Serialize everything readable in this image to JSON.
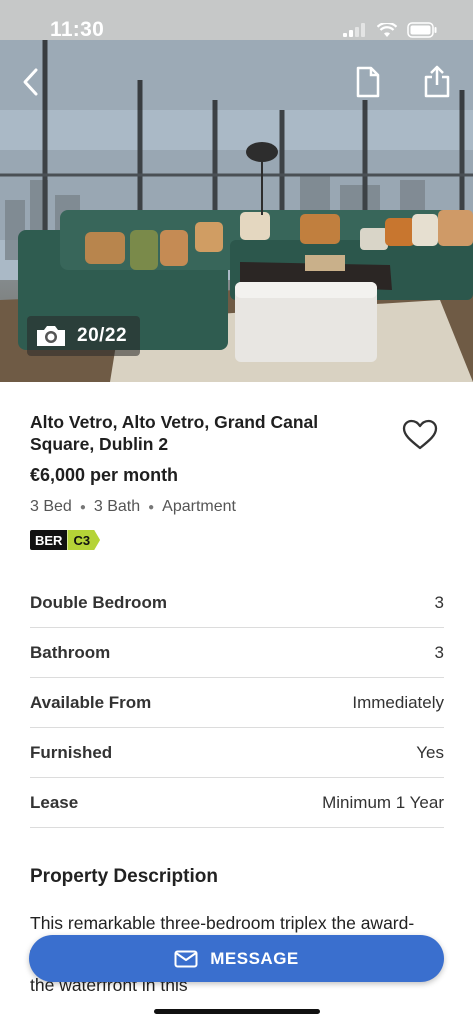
{
  "status_bar": {
    "time": "11:30"
  },
  "hero": {
    "photo_counter": "20/22",
    "icons": {
      "back": "chevron-left-icon",
      "brochure": "document-icon",
      "share": "share-icon",
      "camera": "camera-icon"
    }
  },
  "listing": {
    "address": "Alto Vetro, Alto Vetro, Grand Canal Square, Dublin 2",
    "price": "€6,000 per month",
    "beds": "3 Bed",
    "baths": "3 Bath",
    "type": "Apartment",
    "ber_label": "BER",
    "ber_rating": "C3"
  },
  "facts": [
    {
      "label": "Double Bedroom",
      "value": "3"
    },
    {
      "label": "Bathroom",
      "value": "3"
    },
    {
      "label": "Available From",
      "value": "Immediately"
    },
    {
      "label": "Furnished",
      "value": "Yes"
    },
    {
      "label": "Lease",
      "value": "Minimum 1 Year"
    }
  ],
  "description": {
    "title": "Property Description",
    "text": "This remarkable three-bedroom triplex the award-winning alto vetro, affords you spectacular views of the waterfront in this"
  },
  "actions": {
    "message_label": "MESSAGE"
  },
  "colors": {
    "accent": "#3a6fce",
    "ber_green": "#b5d337"
  }
}
